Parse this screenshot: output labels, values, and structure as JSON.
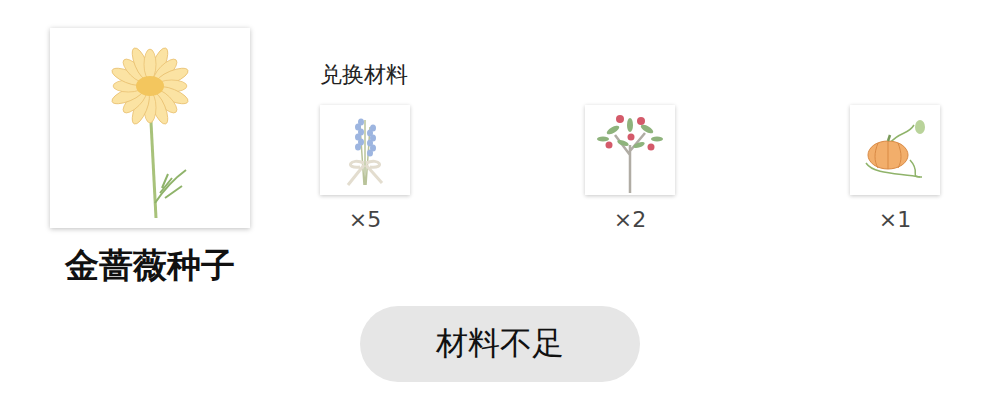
{
  "item": {
    "name": "金蔷薇种子"
  },
  "exchange": {
    "label": "兑换材料",
    "materials": [
      {
        "count": "×5"
      },
      {
        "count": "×2"
      },
      {
        "count": "×1"
      }
    ]
  },
  "button": {
    "label": "材料不足",
    "disabled": true
  }
}
